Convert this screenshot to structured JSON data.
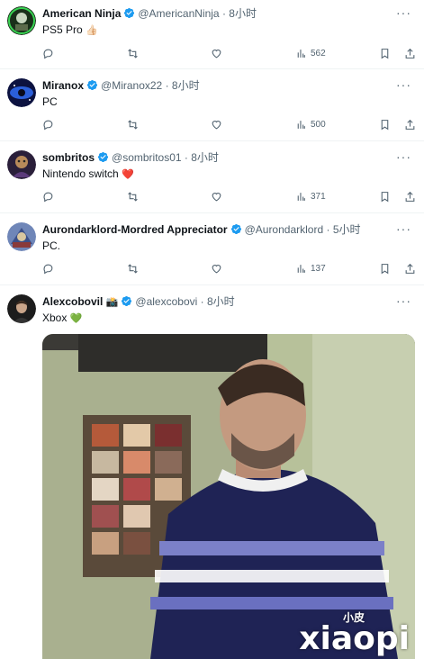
{
  "tweets": [
    {
      "name": "American Ninja",
      "handle": "@AmericanNinja",
      "sep": "·",
      "time": "8小时",
      "text": "PS5 Pro",
      "text_emoji": "👍🏻",
      "views": "562",
      "avatar_color": "#1a2f1a"
    },
    {
      "name": "Miranox",
      "handle": "@Miranox22",
      "sep": "·",
      "time": "8小时",
      "text": "PC",
      "views": "500",
      "avatar_color": "#1b2a7a"
    },
    {
      "name": "sombritos",
      "handle": "@sombritos01",
      "sep": "·",
      "time": "8小时",
      "text": "Nintendo switch",
      "text_emoji": "❤️",
      "views": "371",
      "avatar_color": "#3a2b4a"
    },
    {
      "name": "Aurondarklord-Mordred Appreciator",
      "handle": "@Aurondarklord",
      "sep": "·",
      "time": "5小时",
      "text": "PC.",
      "views": "137",
      "avatar_color": "#4a5e8a"
    },
    {
      "name": "Alexcobovil",
      "name_emoji": "📸",
      "handle": "@alexcobovi",
      "sep": "·",
      "time": "8小时",
      "text": "Xbox",
      "text_emoji": "💚",
      "avatar_color": "#222222"
    }
  ],
  "watermark": {
    "small": "小皮",
    "big": "xiaopi"
  },
  "colors": {
    "verified": "#1d9bf0",
    "icon_gray": "#536471",
    "divider": "#eff3f4"
  }
}
